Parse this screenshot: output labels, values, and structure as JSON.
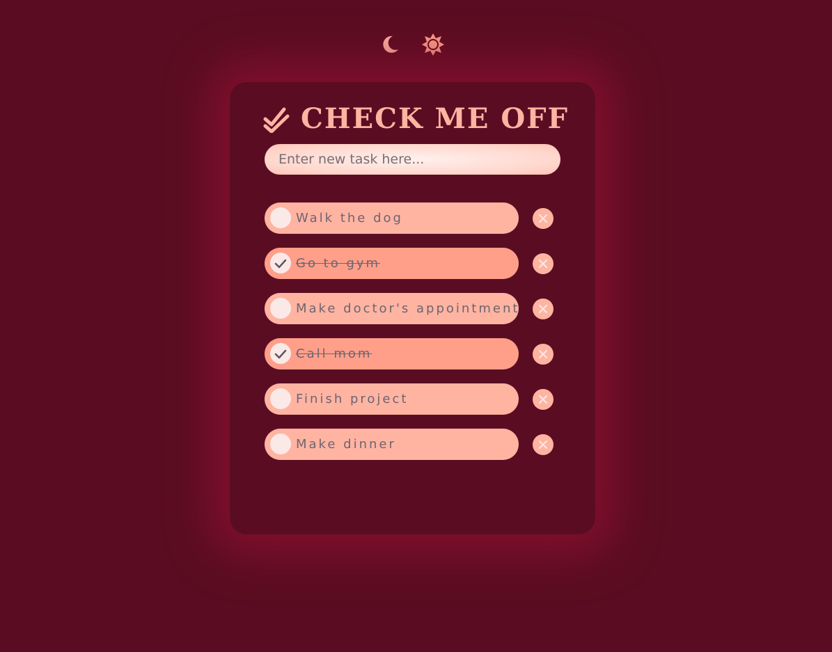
{
  "theme_toggle": {
    "dark_icon": "moon-icon",
    "light_icon": "sun-icon"
  },
  "header": {
    "logo_icon": "double-check-icon",
    "title": "CHECK ME OFF"
  },
  "new_task": {
    "placeholder": "Enter new task here..."
  },
  "tasks": [
    {
      "label": "Walk the dog",
      "completed": false
    },
    {
      "label": "Go to gym",
      "completed": true
    },
    {
      "label": "Make doctor's appointment",
      "completed": false
    },
    {
      "label": "Call mom",
      "completed": true
    },
    {
      "label": "Finish project",
      "completed": false
    },
    {
      "label": "Make dinner",
      "completed": false
    }
  ],
  "colors": {
    "background": "#5a0d22",
    "accent": "#ffb4a2",
    "accent_done": "#ff9f8a",
    "text": "#6d6470"
  }
}
